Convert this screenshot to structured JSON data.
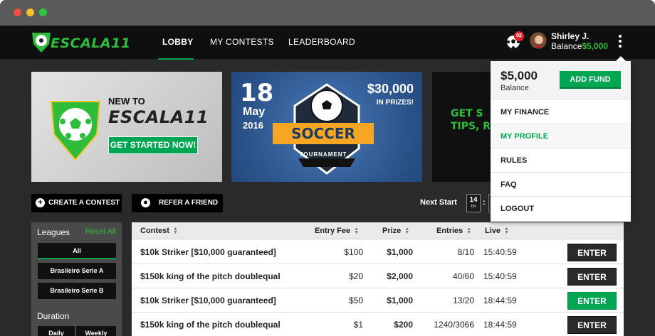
{
  "brand": {
    "logo_text": "ESCALA11",
    "accent": "#00a651"
  },
  "nav": {
    "tabs": [
      {
        "label": "LOBBY",
        "active": true
      },
      {
        "label": "MY CONTESTS",
        "active": false
      },
      {
        "label": "LEADERBOARD",
        "active": false
      }
    ]
  },
  "user": {
    "notification_count": "02",
    "name": "Shirley J.",
    "balance_label": "Balance",
    "balance_amount": "$5,000"
  },
  "banners": {
    "promo1": {
      "line1": "NEW TO",
      "line2": "ESCALA11",
      "button": "GET STARTED NOW!"
    },
    "promo2": {
      "day": "18",
      "month": "May",
      "year": "2016",
      "prize": "$30,000",
      "prize_note": "IN PRIZES!",
      "title": "SOCCER",
      "subtitle": "TOURNAMENT"
    },
    "promo3": {
      "line1": "GET S",
      "line2": "TIPS, R"
    }
  },
  "actions": {
    "create_contest": "CREATE A CONTEST",
    "refer_friend": "REFER A FRIEND"
  },
  "next_start": {
    "label": "Next Start",
    "hours": "14",
    "hours_unit": "hh",
    "colon": ":"
  },
  "sidebar": {
    "leagues_title": "Leagues",
    "reset_all": "Reset All",
    "leagues": [
      "All",
      "Brasileiro Serie A",
      "Brasileiro Serie B"
    ],
    "duration_title": "Duration",
    "durations": [
      "Daily",
      "Weekly"
    ]
  },
  "table": {
    "headers": {
      "contest": "Contest",
      "entry_fee": "Entry Fee",
      "prize": "Prize",
      "entries": "Entries",
      "live": "Live"
    },
    "rows": [
      {
        "contest": "$10k Striker [$10,000 guaranteed]",
        "fee": "$100",
        "prize": "$1,000",
        "entries": "8/10",
        "live": "15:40:59",
        "action": "ENTER",
        "highlight": false
      },
      {
        "contest": "$150k king of the pitch doublequal",
        "fee": "$20",
        "prize": "$2,000",
        "entries": "40/60",
        "live": "15:40:59",
        "action": "ENTER",
        "highlight": false
      },
      {
        "contest": "$10k Striker [$10,000 guaranteed]",
        "fee": "$50",
        "prize": "$1,000",
        "entries": "13/20",
        "live": "18:44:59",
        "action": "ENTER",
        "highlight": true
      },
      {
        "contest": "$150k king of the pitch doublequal",
        "fee": "$1",
        "prize": "$200",
        "entries": "1240/3066",
        "live": "18:44:59",
        "action": "ENTER",
        "highlight": false
      }
    ]
  },
  "dropdown": {
    "balance": "$5,000",
    "balance_label": "Balance",
    "add_fund": "ADD FUND",
    "items": [
      {
        "label": "MY FINANCE",
        "active": false
      },
      {
        "label": "MY PROFILE",
        "active": true
      },
      {
        "label": "RULES",
        "active": false
      },
      {
        "label": "FAQ",
        "active": false
      },
      {
        "label": "LOGOUT",
        "active": false
      }
    ]
  }
}
